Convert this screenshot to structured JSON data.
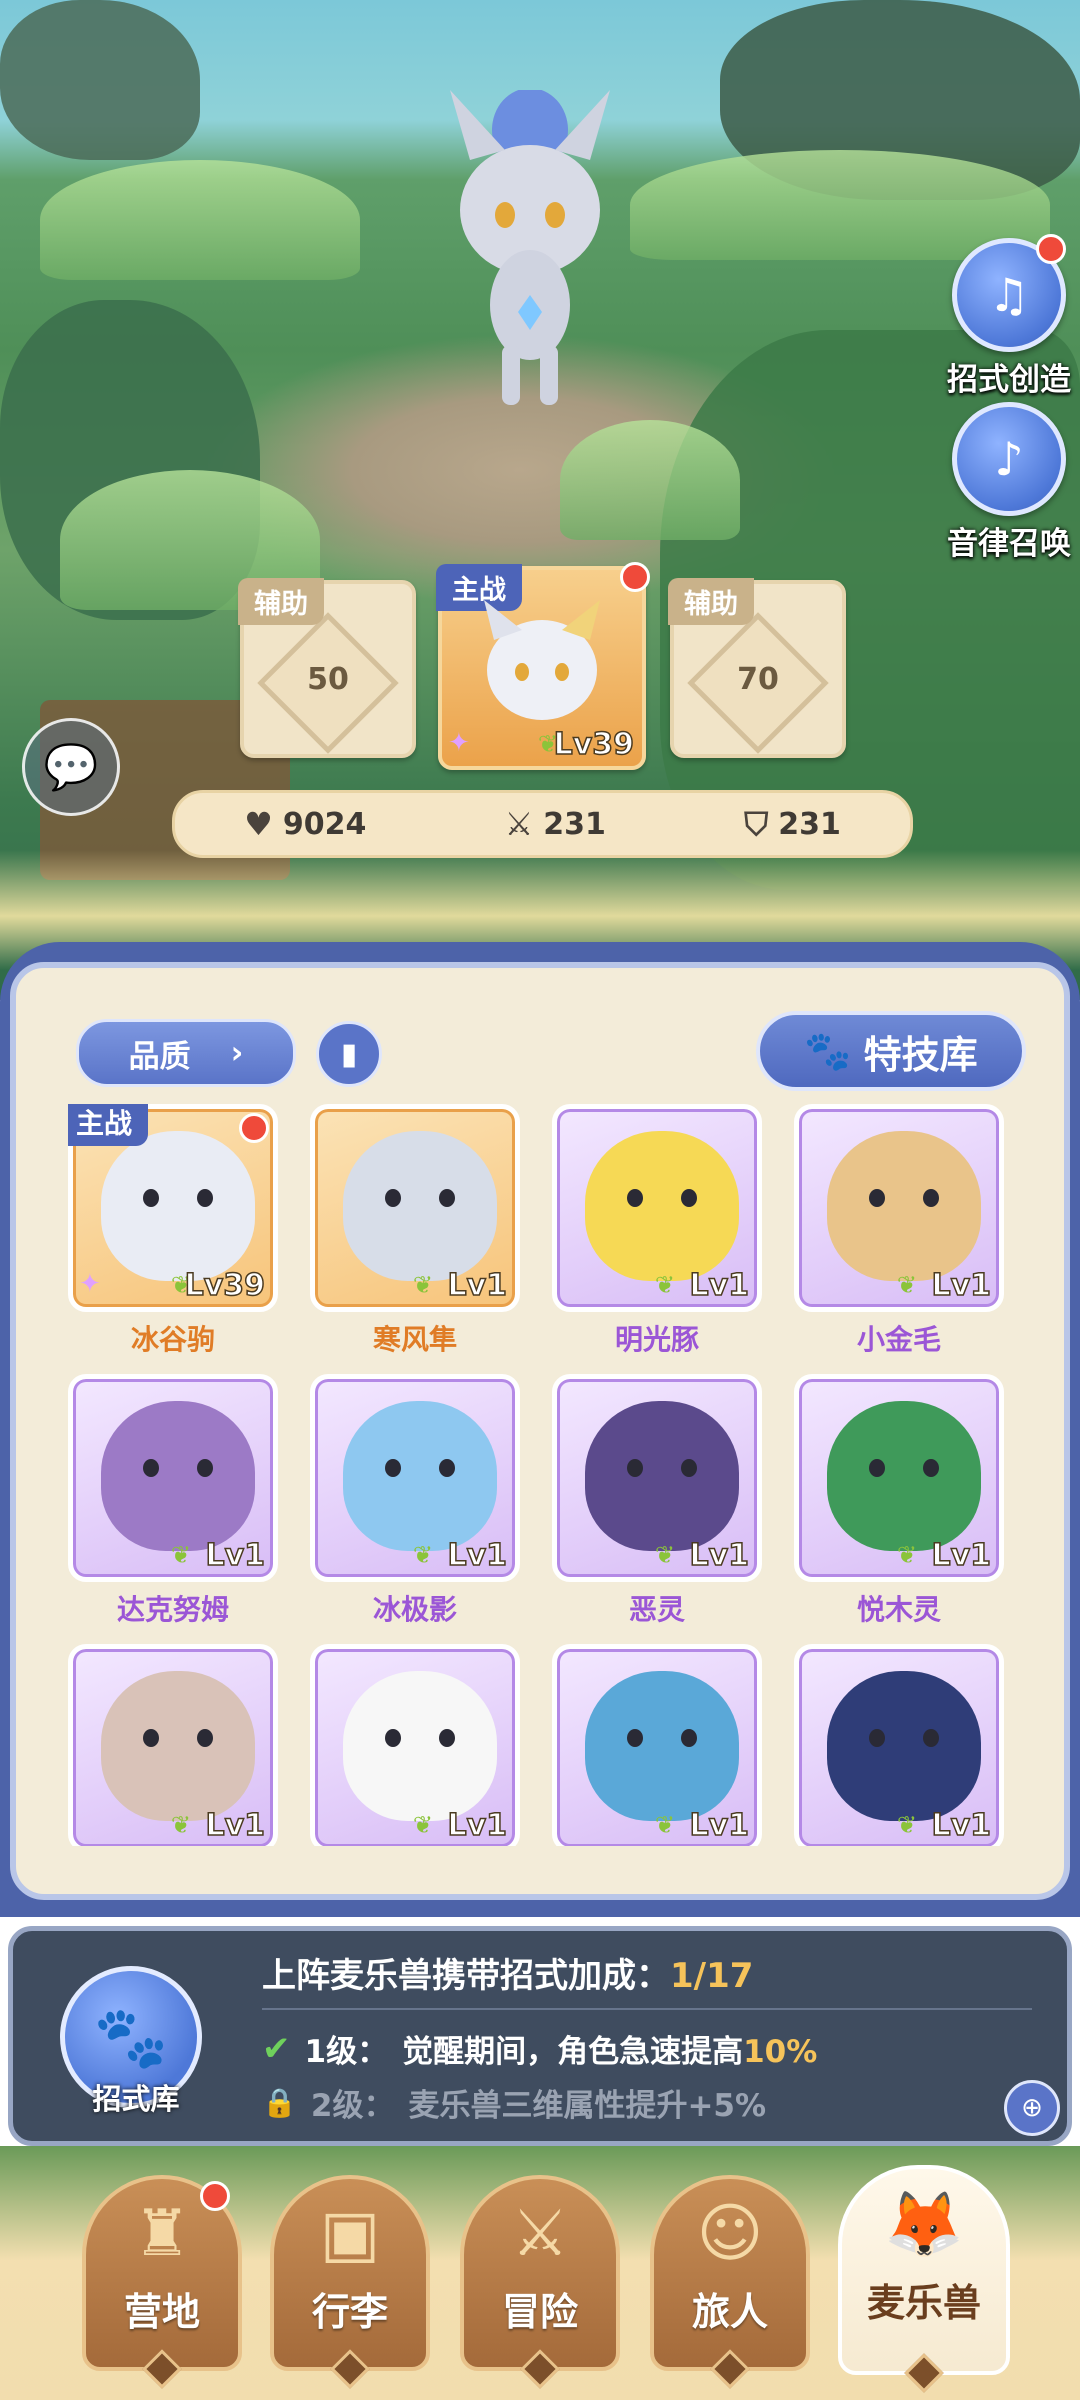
{
  "side_buttons": [
    {
      "label": "招式创造",
      "icon": "music-book-icon",
      "has_badge": true
    },
    {
      "label": "音律召唤",
      "icon": "lyre-icon",
      "has_badge": false
    }
  ],
  "lineup": {
    "left": {
      "tag": "辅助",
      "value": "50"
    },
    "main": {
      "tag": "主战",
      "level": "Lv39"
    },
    "right": {
      "tag": "辅助",
      "value": "70"
    }
  },
  "stats": {
    "hp": "9024",
    "attack": "231",
    "defense": "231"
  },
  "panel": {
    "filter_label": "品质",
    "skill_library_label": "特技库"
  },
  "pets": [
    {
      "name": "冰谷驹",
      "level": "Lv39",
      "rarity": "orange",
      "main": true,
      "main_tag": "主战",
      "color": "#e9ecf4"
    },
    {
      "name": "寒风隼",
      "level": "Lv1",
      "rarity": "orange",
      "main": false,
      "color": "#d7dde8"
    },
    {
      "name": "明光豚",
      "level": "Lv1",
      "rarity": "purple",
      "main": false,
      "color": "#f6d955"
    },
    {
      "name": "小金毛",
      "level": "Lv1",
      "rarity": "purple",
      "main": false,
      "color": "#e9c48a"
    },
    {
      "name": "达克努姆",
      "level": "Lv1",
      "rarity": "purple",
      "main": false,
      "color": "#9c7ac6"
    },
    {
      "name": "冰极影",
      "level": "Lv1",
      "rarity": "purple",
      "main": false,
      "color": "#8ec8f0"
    },
    {
      "name": "恶灵",
      "level": "Lv1",
      "rarity": "purple",
      "main": false,
      "color": "#5b4a8c"
    },
    {
      "name": "悦木灵",
      "level": "Lv1",
      "rarity": "purple",
      "main": false,
      "color": "#3f9a5a"
    },
    {
      "name": "",
      "level": "Lv1",
      "rarity": "purple",
      "main": false,
      "color": "#d9c2b8"
    },
    {
      "name": "",
      "level": "Lv1",
      "rarity": "purple",
      "main": false,
      "color": "#f7f7f7"
    },
    {
      "name": "",
      "level": "Lv1",
      "rarity": "purple",
      "main": false,
      "color": "#5aa8d8"
    },
    {
      "name": "",
      "level": "Lv1",
      "rarity": "purple",
      "main": false,
      "color": "#2f3d78"
    }
  ],
  "bonus": {
    "icon_label": "招式库",
    "title": "上阵麦乐兽携带招式加成：",
    "progress": "1/17",
    "line1_level": "1级：",
    "line1_text": "觉醒期间，角色急速提高",
    "line1_value": "10%",
    "line2_level": "2级：",
    "line2_text": "麦乐兽三维属性提升+5%"
  },
  "nav": [
    {
      "label": "营地",
      "icon": "castle-icon",
      "badge": true
    },
    {
      "label": "行李",
      "icon": "backpack-icon",
      "badge": false
    },
    {
      "label": "冒险",
      "icon": "crossed-swords-icon",
      "badge": false
    },
    {
      "label": "旅人",
      "icon": "traveler-icon",
      "badge": false
    },
    {
      "label": "麦乐兽",
      "icon": "fox-pet-icon",
      "badge": false,
      "active": true
    }
  ]
}
